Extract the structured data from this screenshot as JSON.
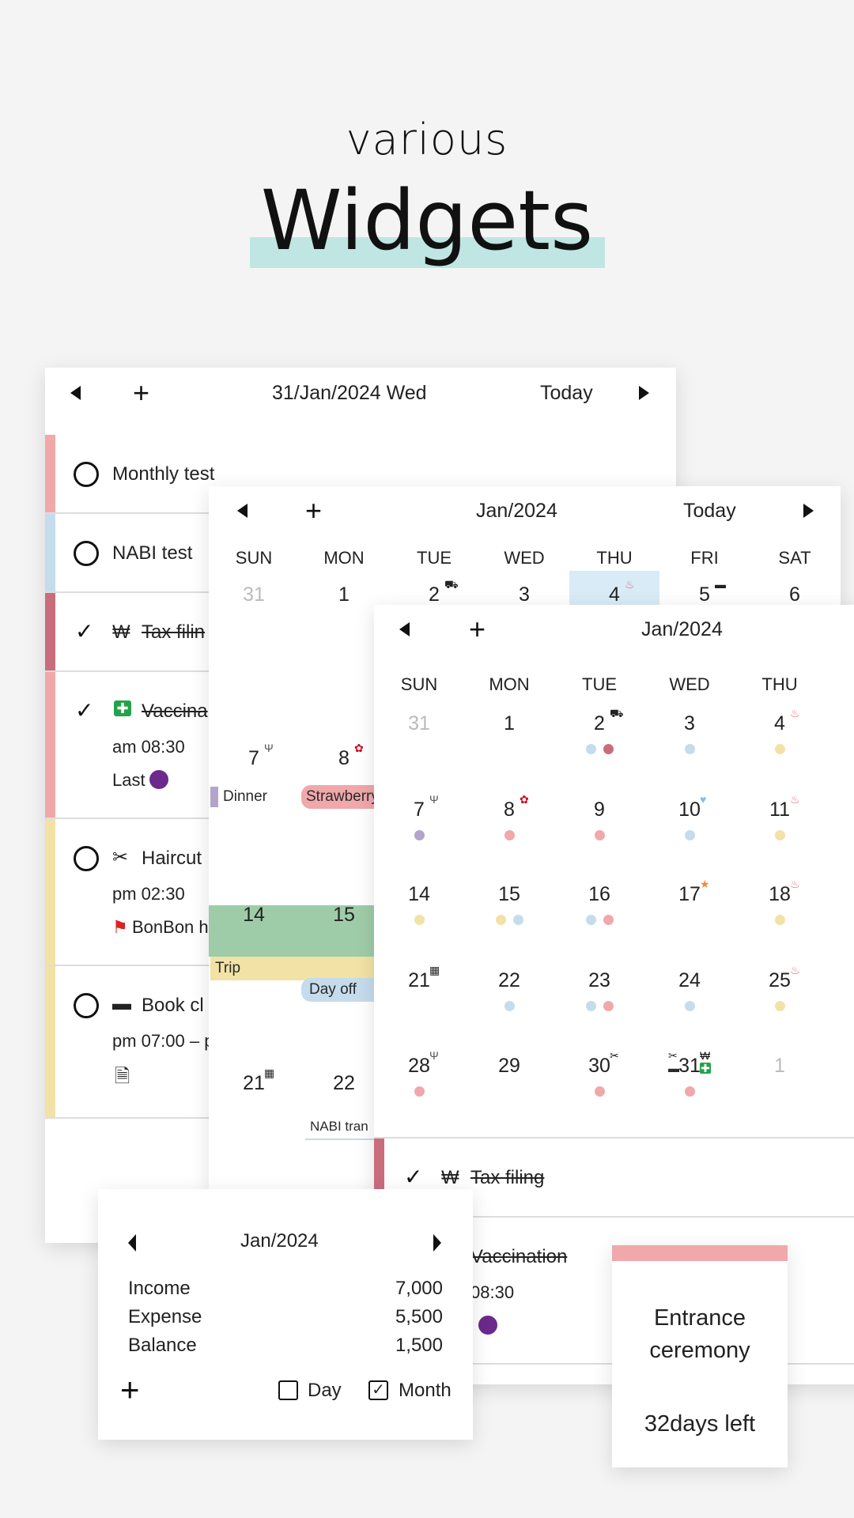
{
  "hero": {
    "line1": "various",
    "line2": "Widgets",
    "highlight_color": "#bfe6e2"
  },
  "colors": {
    "blue": "#c5dced",
    "darkpink": "#c96d7d",
    "yellow": "#f2e2a6",
    "pink": "#f0a8ab",
    "purple": "#b3a5c9",
    "green": "#9fcca8",
    "today": "#d8ebf7"
  },
  "day_widget": {
    "date": "31/Jan/2024 Wed",
    "today_label": "Today",
    "items": [
      {
        "title": "Monthly test",
        "done": false,
        "color": "#f0a8ab"
      },
      {
        "title": "NABI test",
        "done": false,
        "color": "#c5dced"
      },
      {
        "title": "Tax filin",
        "icon": "won-icon",
        "done": true,
        "color": "#c96d7d"
      },
      {
        "title": "Vaccina",
        "icon": "medical-icon",
        "done": true,
        "color": "#f0a8ab",
        "time": "am 08:30",
        "note": "Last"
      },
      {
        "title": "Haircut",
        "icon": "scissors-icon",
        "done": false,
        "color": "#f2e2a6",
        "time": "pm 02:30",
        "note": "BonBon h"
      },
      {
        "title": "Book cl",
        "icon": "book-icon",
        "done": false,
        "color": "#f2e2a6",
        "time": "pm 07:00 – p",
        "note_icon": "document-icon"
      }
    ]
  },
  "month_widget": {
    "title": "Jan/2024",
    "today_label": "Today",
    "weekdays": [
      "SUN",
      "MON",
      "TUE",
      "WED",
      "THU",
      "FRI",
      "SAT"
    ],
    "rows": [
      [
        {
          "d": "31",
          "muted": true
        },
        {
          "d": "1"
        },
        {
          "d": "2",
          "icon": "car"
        },
        {
          "d": "3"
        },
        {
          "d": "4",
          "icon": "meditate",
          "today": true
        },
        {
          "d": "5",
          "icon": "book"
        },
        {
          "d": "6"
        }
      ],
      [
        {
          "d": "7",
          "icon": "utensils"
        },
        {
          "d": "8",
          "icon": "flower"
        }
      ],
      [
        {
          "d": "14"
        },
        {
          "d": "15"
        }
      ],
      [
        {
          "d": "21",
          "icon": "film"
        },
        {
          "d": "22"
        }
      ]
    ],
    "events": {
      "dinner": "Dinner",
      "strawberry": "Strawberry",
      "trip": "Trip",
      "dayoff": "Day off",
      "nabi": "NABI tran"
    }
  },
  "small_calendar": {
    "title": "Jan/2024",
    "weekdays": [
      "SUN",
      "MON",
      "TUE",
      "WED",
      "THU"
    ],
    "rows": [
      [
        {
          "d": "31",
          "muted": true
        },
        {
          "d": "1"
        },
        {
          "d": "2",
          "icon": "car",
          "dots": [
            "blue",
            "darkpink"
          ]
        },
        {
          "d": "3",
          "dots": [
            "blue"
          ]
        },
        {
          "d": "4",
          "icon": "meditate",
          "dots": [
            "yellow"
          ]
        }
      ],
      [
        {
          "d": "7",
          "icon": "utensils",
          "dots": [
            "purple"
          ]
        },
        {
          "d": "8",
          "icon": "flower",
          "dots": [
            "pink"
          ]
        },
        {
          "d": "9",
          "dots": [
            "pink"
          ]
        },
        {
          "d": "10",
          "icon": "heart",
          "dots": [
            "blue"
          ]
        },
        {
          "d": "11",
          "icon": "meditate",
          "dots": [
            "yellow"
          ]
        }
      ],
      [
        {
          "d": "14",
          "dots": [
            "yellow"
          ]
        },
        {
          "d": "15",
          "dots": [
            "yellow",
            "blue"
          ]
        },
        {
          "d": "16",
          "dots": [
            "blue",
            "pink"
          ]
        },
        {
          "d": "17",
          "icon": "star"
        },
        {
          "d": "18",
          "icon": "meditate",
          "dots": [
            "yellow"
          ]
        }
      ],
      [
        {
          "d": "21",
          "icon": "film"
        },
        {
          "d": "22",
          "dots": [
            "blue"
          ]
        },
        {
          "d": "23",
          "dots": [
            "blue",
            "pink"
          ]
        },
        {
          "d": "24",
          "dots": [
            "blue"
          ]
        },
        {
          "d": "25",
          "icon": "meditate",
          "dots": [
            "yellow"
          ]
        }
      ],
      [
        {
          "d": "28",
          "icon": "utensils",
          "dots": [
            "pink"
          ]
        },
        {
          "d": "29"
        },
        {
          "d": "30",
          "icon": "scissors",
          "dots": [
            "pink"
          ]
        },
        {
          "d": "31",
          "icon": "won",
          "icon_left": "scissors",
          "dots": [
            "pink"
          ]
        },
        {
          "d": "1",
          "muted": true
        }
      ]
    ],
    "list": [
      {
        "title": "Tax filing",
        "icon": "₩",
        "done": true
      },
      {
        "title": "Vaccination",
        "done": true,
        "time": "08:30"
      }
    ]
  },
  "finance_widget": {
    "title": "Jan/2024",
    "rows": [
      {
        "label": "Income",
        "value": "7,000"
      },
      {
        "label": "Expense",
        "value": "5,500"
      },
      {
        "label": "Balance",
        "value": "1,500"
      }
    ],
    "day_label": "Day",
    "day_checked": false,
    "month_label": "Month",
    "month_checked": true
  },
  "dday_widget": {
    "line1": "Entrance",
    "line2": "ceremony",
    "left": "32days left",
    "color": "#f0a8ab"
  }
}
